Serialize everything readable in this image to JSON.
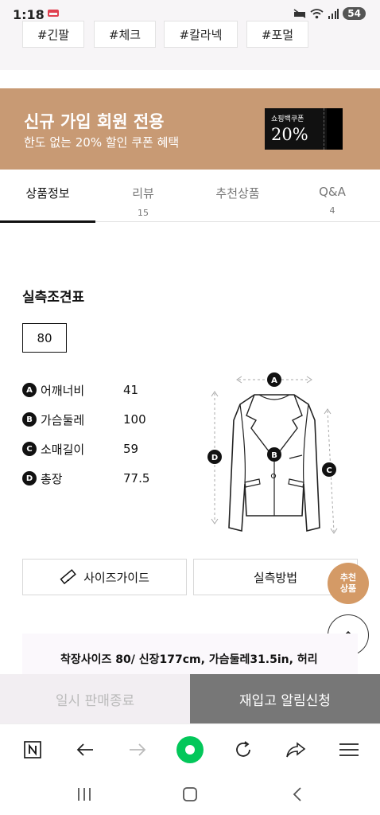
{
  "status": {
    "time": "1:18",
    "battery": "54"
  },
  "tags": [
    "#긴팔",
    "#체크",
    "#칼라넥",
    "#포멀"
  ],
  "promo": {
    "title": "신규 가입 회원 전용",
    "subtitle": "한도 없는 20% 할인 쿠폰 혜택",
    "coupon_label": "쇼핑백쿠폰",
    "coupon_value": "20%",
    "bg_color": "#c89a74"
  },
  "tabs": [
    {
      "label": "상품정보",
      "count": ""
    },
    {
      "label": "리뷰",
      "count": "15"
    },
    {
      "label": "추천상품",
      "count": ""
    },
    {
      "label": "Q&A",
      "count": "4"
    }
  ],
  "size_chart": {
    "title": "실측조견표",
    "selected_size": "80",
    "measurements": [
      {
        "badge": "A",
        "label": "어깨너비",
        "value": "41"
      },
      {
        "badge": "B",
        "label": "가슴둘레",
        "value": "100"
      },
      {
        "badge": "C",
        "label": "소매길이",
        "value": "59"
      },
      {
        "badge": "D",
        "label": "총장",
        "value": "77.5"
      }
    ],
    "diagram_badges": {
      "a": "A",
      "b": "B",
      "c": "C",
      "d": "D"
    }
  },
  "buttons": {
    "size_guide": "사이즈가이드",
    "measure_method": "실측방법",
    "reco_line1": "추천",
    "reco_line2": "상품"
  },
  "fit_info": "착장사이즈 80/ 신장177cm, 가슴둘레31.5in, 허리",
  "actions": {
    "sold_out": "일시 판매종료",
    "restock": "재입고 알림신청"
  }
}
